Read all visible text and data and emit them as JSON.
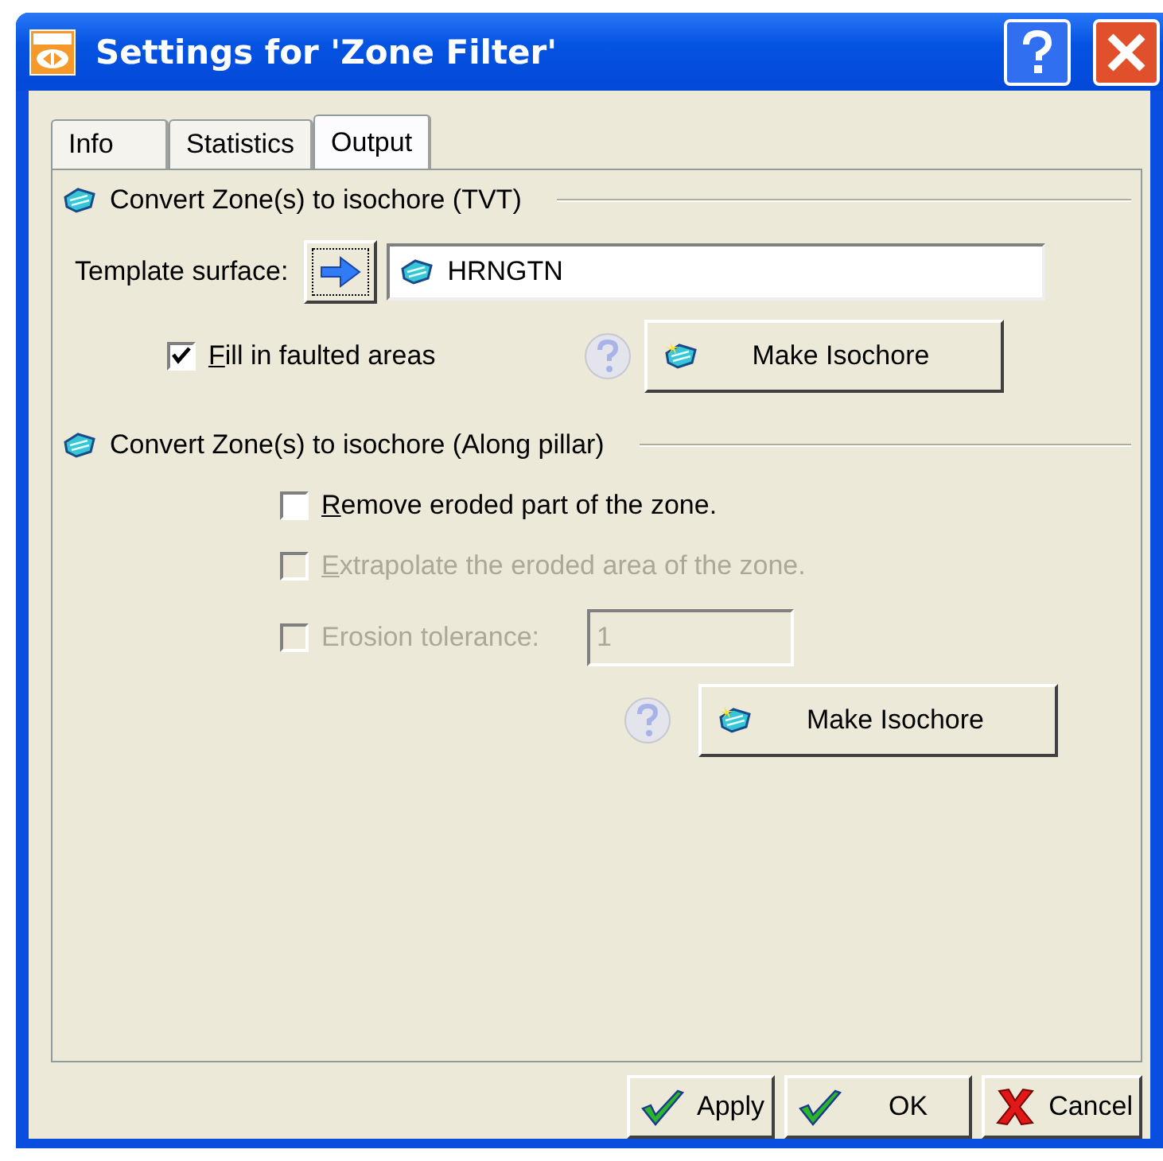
{
  "window": {
    "title": "Settings for 'Zone Filter'"
  },
  "tabs": [
    {
      "label": "Info",
      "selected": false
    },
    {
      "label": "Statistics",
      "selected": false
    },
    {
      "label": "Output",
      "selected": true
    }
  ],
  "tvt": {
    "heading": "Convert Zone(s) to isochore (TVT)",
    "template_label": "Template surface:",
    "template_value": "HRNGTN",
    "checkbox": {
      "label": "Fill in faulted areas",
      "checked": true,
      "disabled": false
    },
    "button": "Make Isochore"
  },
  "pillar": {
    "heading": "Convert Zone(s) to isochore (Along pillar)",
    "checkboxes": [
      {
        "kind": "plain",
        "label": "Remove eroded part of the zone.",
        "checked": false,
        "disabled": false
      },
      {
        "kind": "plain",
        "label": "Extrapolate the eroded area of the zone.",
        "checked": false,
        "disabled": true
      },
      {
        "kind": "field",
        "label": "Erosion tolerance:",
        "checked": false,
        "disabled": true,
        "value": "1"
      }
    ],
    "button": "Make Isochore"
  },
  "buttons": [
    {
      "kind": "apply",
      "label": "Apply"
    },
    {
      "kind": "ok",
      "label": "OK"
    },
    {
      "kind": "cancel",
      "label": "Cancel"
    }
  ]
}
